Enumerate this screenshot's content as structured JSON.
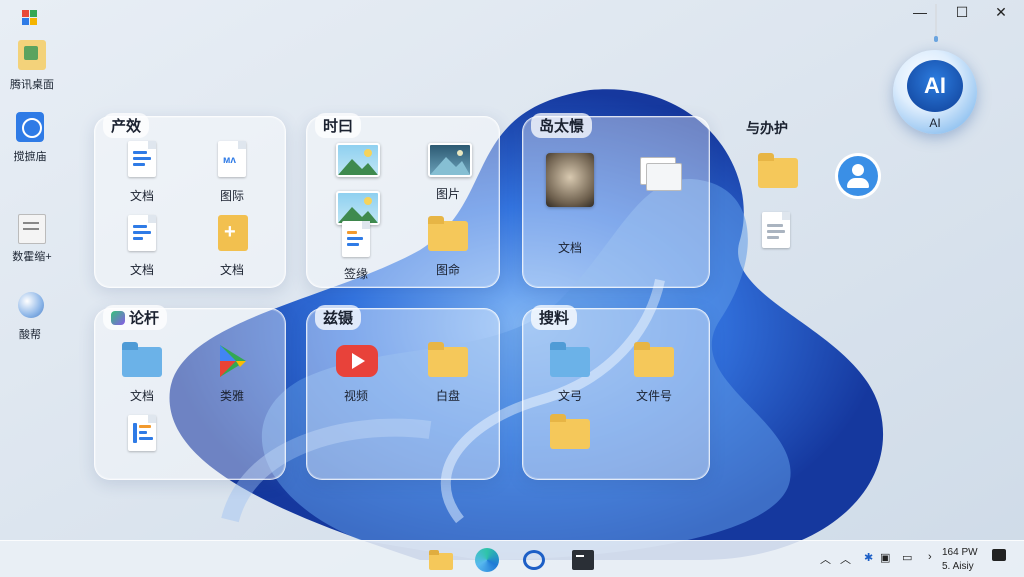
{
  "desktop_icons": [
    {
      "label": "腾讯桌面",
      "icon": "tencent-desktop-icon"
    },
    {
      "label": "搅摭庙",
      "icon": "app-store-icon"
    },
    {
      "label": "数霍缩+",
      "icon": "document-scanner-icon"
    },
    {
      "label": "酸帮",
      "icon": "settings-ball-icon"
    }
  ],
  "groups": [
    {
      "title": "产效",
      "items": [
        {
          "label": "文档",
          "icon": "document-icon"
        },
        {
          "label": "图际",
          "icon": "image-file-icon"
        },
        {
          "label": "文档",
          "icon": "document-icon"
        },
        {
          "label": "文档",
          "icon": "add-file-icon"
        }
      ]
    },
    {
      "title": "时曰",
      "items": [
        {
          "label": "",
          "icon": "landscape-picture-icon"
        },
        {
          "label": "图片",
          "icon": "landscape-picture-icon"
        },
        {
          "label": "签缘",
          "icon": "document-icon"
        },
        {
          "label": "图命",
          "icon": "folder-icon"
        }
      ]
    },
    {
      "title": "岛太憬",
      "items": [
        {
          "label": "文档",
          "icon": "hedgehog-photo-icon"
        },
        {
          "label": "",
          "icon": "gallery-icon"
        }
      ]
    },
    {
      "title": "论杆",
      "items": [
        {
          "label": "文档",
          "icon": "blue-folder-icon"
        },
        {
          "label": "类雅",
          "icon": "play-store-icon"
        },
        {
          "label": "",
          "icon": "chart-doc-icon"
        }
      ]
    },
    {
      "title": "兹镊",
      "items": [
        {
          "label": "视频",
          "icon": "video-play-icon"
        },
        {
          "label": "白盘",
          "icon": "folder-icon"
        }
      ]
    },
    {
      "title": "搜料",
      "items": [
        {
          "label": "文弓",
          "icon": "blue-folder-icon"
        },
        {
          "label": "文件号",
          "icon": "folder-icon"
        },
        {
          "label": "",
          "icon": "folder-icon"
        }
      ]
    }
  ],
  "loose": {
    "title": "与办护",
    "items": [
      "folder-icon",
      "document-icon",
      "user-icon"
    ]
  },
  "ai_assistant": {
    "badge": "AI",
    "label": "AI"
  },
  "window_controls": {
    "minimize": "—",
    "maximize": "☐",
    "close": "✕"
  },
  "taskbar": {
    "apps": [
      "file-explorer-icon",
      "edge-icon",
      "chat-icon",
      "terminal-icon"
    ],
    "tray_time": "164 PW",
    "tray_date": "5. Aisiy"
  },
  "colors": {
    "accent": "#2f7be6",
    "folder": "#f5c85a",
    "folder_blue": "#6bb2e8"
  }
}
